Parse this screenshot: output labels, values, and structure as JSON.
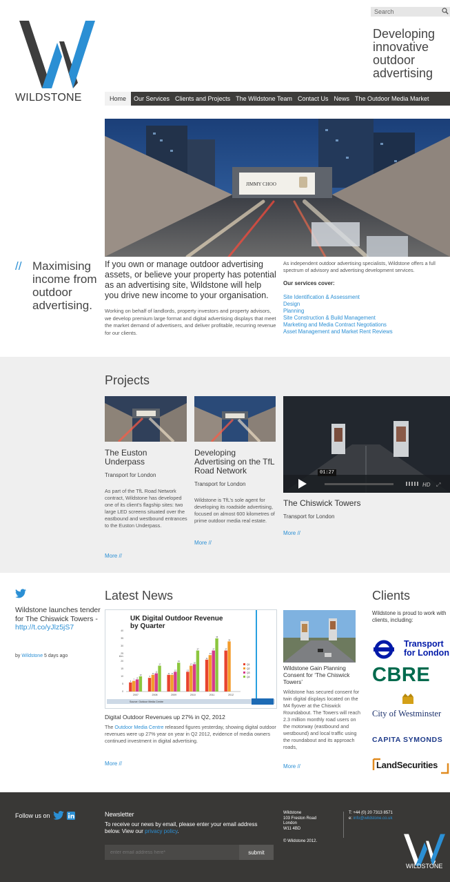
{
  "header": {
    "logo_text": "WILDSTONE",
    "search_placeholder": "Search",
    "tagline": "Developing innovative outdoor advertising"
  },
  "nav": [
    {
      "label": "Home",
      "active": true
    },
    {
      "label": "Our Services"
    },
    {
      "label": "Clients and Projects"
    },
    {
      "label": "The Wildstone Team"
    },
    {
      "label": "Contact Us"
    },
    {
      "label": "News"
    },
    {
      "label": "The Outdoor Media Market"
    }
  ],
  "hero": {
    "billboard_text": "JIMMY CHOO"
  },
  "intro": {
    "quote_slashes": "//",
    "quote_text": "Maximising income from outdoor advertising.",
    "lead": "If you own or manage outdoor advertising assets, or believe your property has potential as an advertising site, Wildstone will help you drive new income to your organisation.",
    "body": "Working on behalf of landlords, property investors and property advisors, we develop premium large format and digital advertising displays that meet the market demand of advertisers, and deliver profitable, recurring revenue for our clients.",
    "services_intro": "As independent outdoor advertising specialists, Wildstone offers a full spectrum of advisory and advertising development services.",
    "services_heading": "Our services cover:",
    "services": [
      "Site Identification & Assessment",
      "Design",
      "Planning",
      "Site Construction & Build Management",
      "Marketing and Media Contract Negotiations",
      "Asset Management and Market Rent Reviews"
    ]
  },
  "projects": {
    "title": "Projects",
    "items": [
      {
        "title": "The Euston Underpass",
        "client": "Transport for London",
        "text": "As part of the TfL Road Network contract, Wildstone has developed one of its client’s flagship sites: two large LED screens situated over the eastbound and westbound entrances to the Euston Underpass.",
        "more": "More //"
      },
      {
        "title": "Developing Advertising on the TfL Road Network",
        "client": "Transport for London",
        "text": "Wildstone is TfL’s sole agent for developing its roadside advertising, focused on almost 600 kilometres of prime outdoor media real estate.",
        "more": "More //"
      },
      {
        "title": "The Chiswick Towers",
        "client": "Transport for London",
        "more": "More //"
      }
    ],
    "video": {
      "time": "01:27",
      "hd": "HD"
    }
  },
  "twitter": {
    "tweet": "Wildstone launches tender for The Chiswick Towers -",
    "link": "http://t.co/yJlz5jS7",
    "by": "by",
    "author": "Wildstone",
    "ago": "5 days ago"
  },
  "news": {
    "title": "Latest News",
    "article1": {
      "title": "Digital Outdoor Revenues up 27% in Q2, 2012",
      "text_pre": "The",
      "text_link": "Outdoor Media Centre",
      "text_post": "released figures yesterday, showing digital outdoor revenues were up 27% year on year in Q2 2012, evidence of media owners continued investment in digital advertising.",
      "more": "More //"
    },
    "article2": {
      "title": "Wildstone Gain Planning Consent for ‘The Chiswick Towers’",
      "text": "Wildstone has secured consent for twin digital displays located on the M4 flyover at the Chiswick Roundabout. The Towers will reach 2.3 million monthly road users on the motorway (eastbound and westbound) and local traffic using the roundabout and its approach roads,",
      "more": "More //"
    }
  },
  "chart_data": {
    "type": "bar",
    "title": "UK Digital Outdoor Revenue by Quarter",
    "xlabel": "",
    "ylabel": "£m",
    "categories": [
      "2007",
      "2008",
      "2009",
      "2010",
      "2011",
      "2012"
    ],
    "series": [
      {
        "name": "Q1",
        "values": [
          6,
          9,
          11,
          13,
          21,
          27
        ]
      },
      {
        "name": "Q2",
        "values": [
          7,
          11,
          11,
          17,
          24,
          33
        ]
      },
      {
        "name": "Q3",
        "values": [
          8,
          12,
          13,
          18,
          27,
          0
        ]
      },
      {
        "name": "Q4",
        "values": [
          10,
          17,
          19,
          27,
          35,
          0
        ]
      }
    ],
    "ylim": [
      0,
      40
    ],
    "colors": [
      "#e8442f",
      "#f39c2c",
      "#d63a8a",
      "#8cc63f"
    ],
    "source": "Source: Outdoor Media Centre",
    "legend_position": "right",
    "grid": false
  },
  "clients": {
    "title": "Clients",
    "intro": "Wildstone is proud to work with clients, including:",
    "logos": [
      {
        "name": "Transport for London",
        "line1": "Transport",
        "line2": "for London"
      },
      {
        "name": "CBRE",
        "text": "CBRE"
      },
      {
        "name": "City of Westminster",
        "text": "City of Westminster"
      },
      {
        "name": "Capita Symonds",
        "text": "CAPITA SYMONDS"
      },
      {
        "name": "Land Securities",
        "text": "LandSecurities"
      }
    ]
  },
  "footer": {
    "follow": "Follow us on",
    "newsletter_title": "Newsletter",
    "newsletter_text_pre": "To receive our news by email, please enter your email address below. View our",
    "newsletter_link": "privacy policy",
    "newsletter_text_post": ".",
    "email_placeholder": "enter email address here*",
    "submit": "submit",
    "address": [
      "Wildstone",
      "103 Freston Road",
      "London",
      "W11 4BD"
    ],
    "copyright": "© Wildstone 2012.",
    "phone": "T: +44 (0) 20 7313 8571",
    "email_label": "e:",
    "email": "info@wildstone.co.uk",
    "logo_text": "WILDSTONE"
  },
  "colors": {
    "accent": "#2b8fd4",
    "nav_bg": "#3d3c3a",
    "band_bg": "#efefef",
    "footer_bg": "#393836"
  }
}
